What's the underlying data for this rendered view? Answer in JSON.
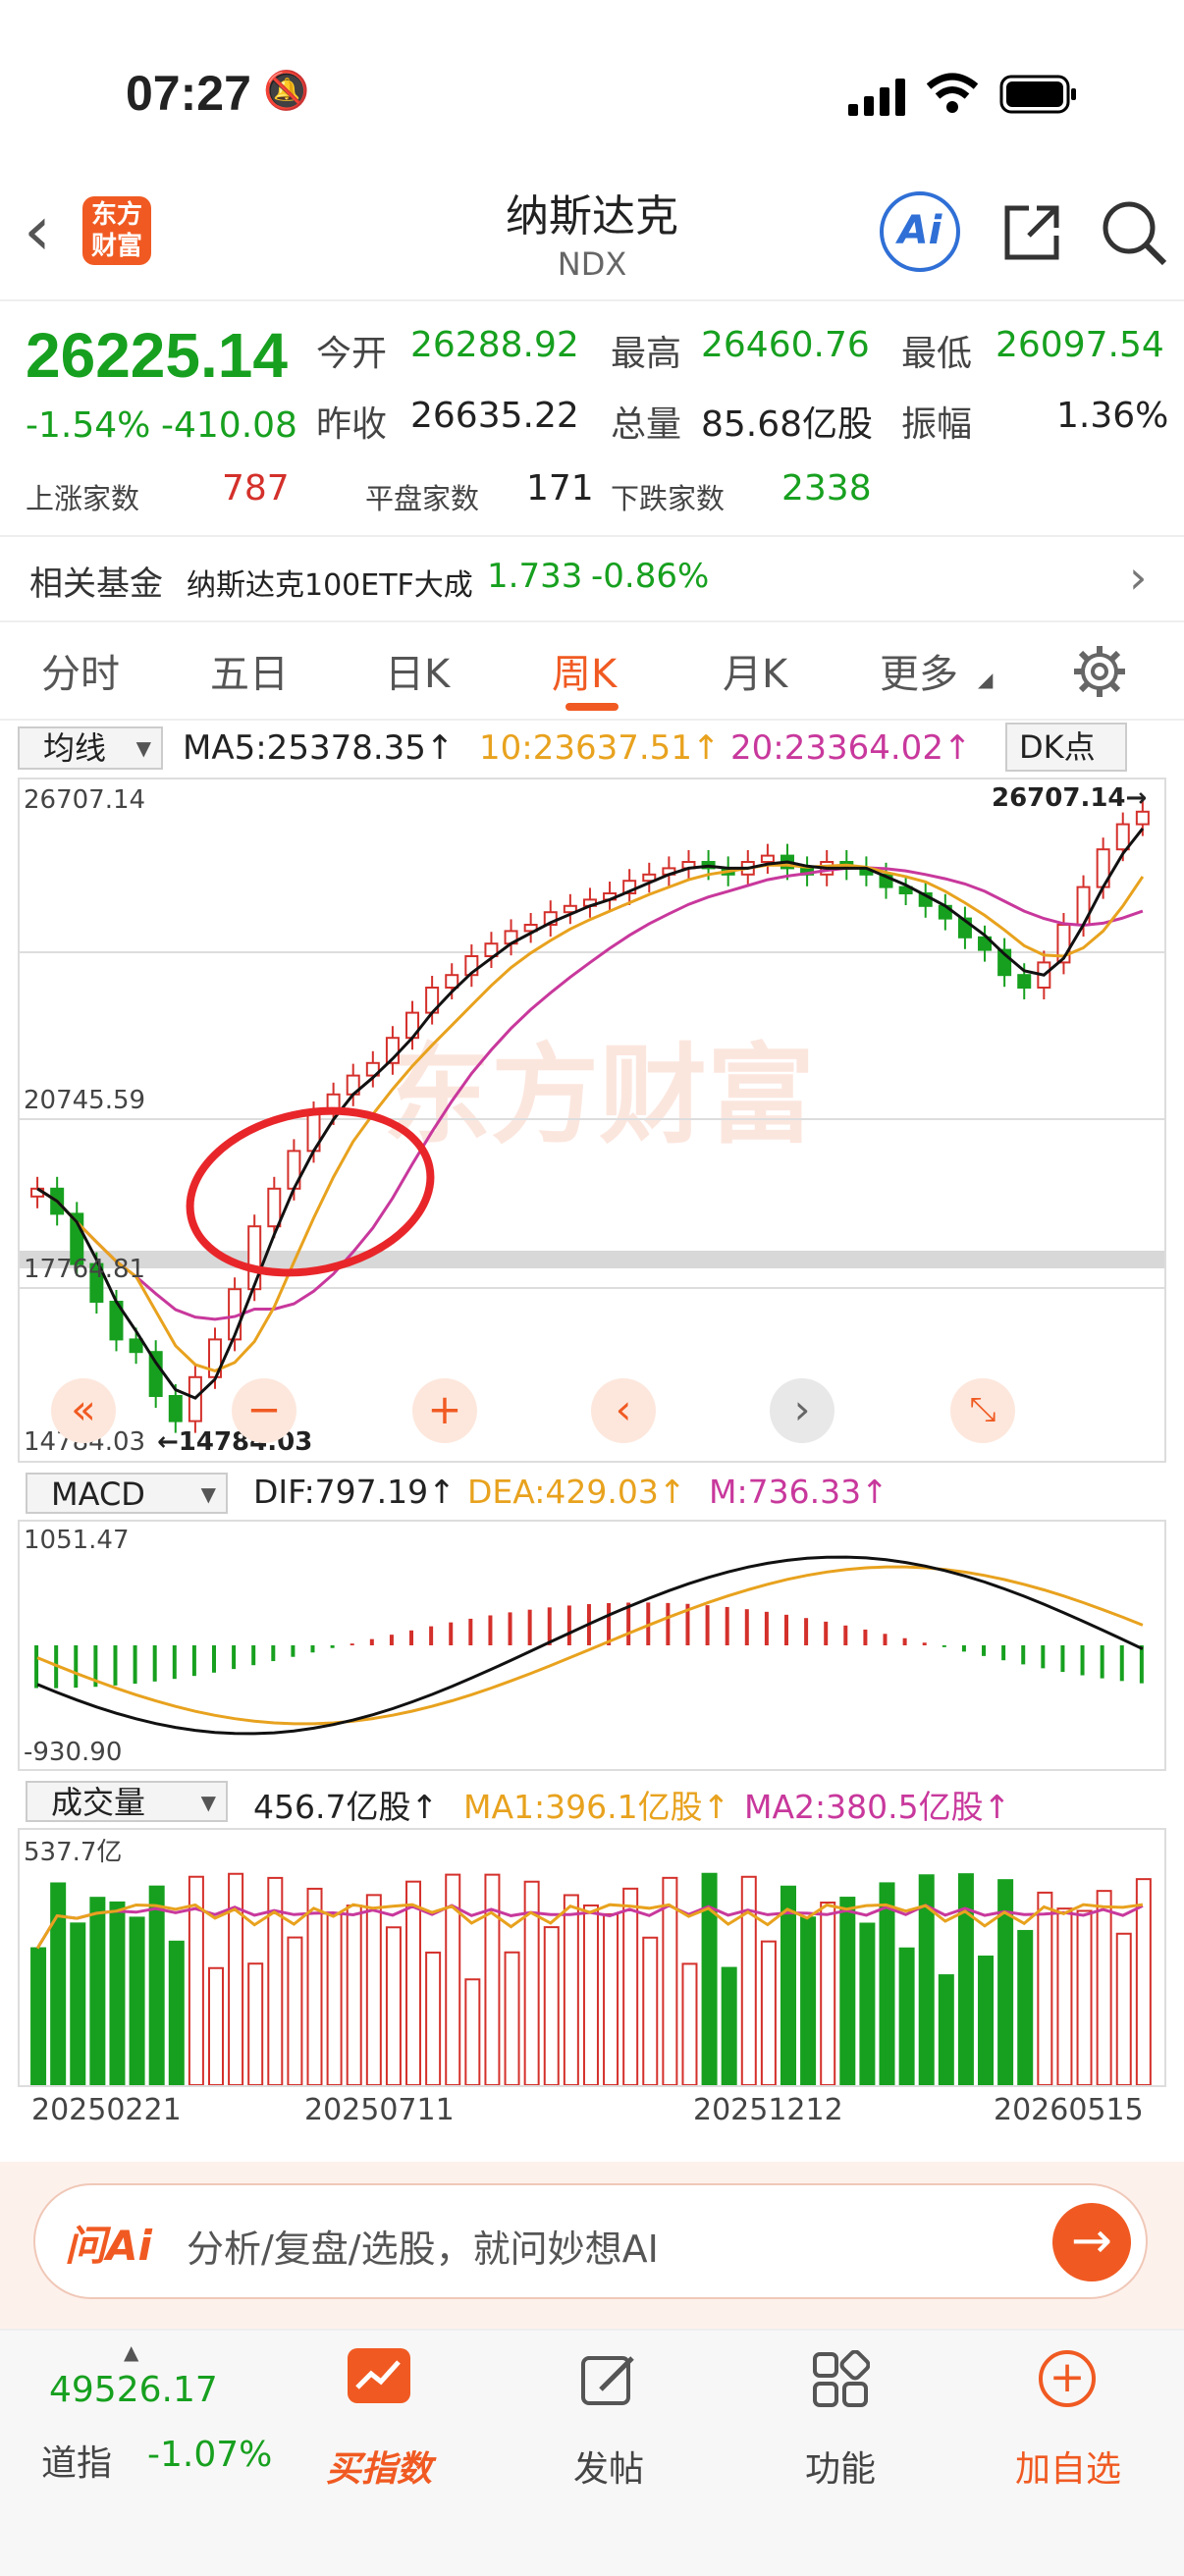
{
  "status": {
    "time": "07:27"
  },
  "header": {
    "title": "纳斯达克",
    "subtitle": "NDX",
    "logo_text": "东方\n财富",
    "ai_label": "Ai"
  },
  "quote": {
    "price": "26225.14",
    "change_pct": "-1.54%",
    "change": "-410.08",
    "open_label": "今开",
    "open": "26288.92",
    "high_label": "最高",
    "high": "26460.76",
    "low_label": "最低",
    "low": "26097.54",
    "prev_label": "昨收",
    "prev": "26635.22",
    "vol_label": "总量",
    "vol": "85.68亿股",
    "amp_label": "振幅",
    "amp": "1.36%",
    "up_label": "上涨家数",
    "up": "787",
    "flat_label": "平盘家数",
    "flat": "171",
    "down_label": "下跌家数",
    "down": "2338"
  },
  "fund": {
    "label": "相关基金",
    "name": "纳斯达克100ETF大成",
    "price": "1.733",
    "pct": "-0.86%"
  },
  "tabs": [
    "分时",
    "五日",
    "日K",
    "周K",
    "月K",
    "更多"
  ],
  "active_tab": 3,
  "kline": {
    "selector": "均线",
    "ma5": "MA5:25378.35↑",
    "ma10": "10:23637.51↑",
    "ma20": "20:23364.02↑",
    "dk": "DK点",
    "y_top": "26707.14",
    "y_mid": "20745.59",
    "y_low": "17764.81",
    "y_bot": "14784.03",
    "max_marker": "26707.14→",
    "min_marker": "←14784.03",
    "watermark": "东方财富"
  },
  "macd": {
    "selector": "MACD",
    "dif": "DIF:797.19↑",
    "dea": "DEA:429.03↑",
    "m": "M:736.33↑",
    "y_top": "1051.47",
    "y_bot": "-930.90"
  },
  "volume": {
    "selector": "成交量",
    "vol": "456.7亿股↑",
    "ma1": "MA1:396.1亿股↑",
    "ma2": "MA2:380.5亿股↑",
    "y_top": "537.7亿"
  },
  "dates": [
    "20250221",
    "20250711",
    "20251212",
    "20260515"
  ],
  "ai": {
    "brand": "问Ai",
    "placeholder": "分析/复盘/选股，就问妙想AI"
  },
  "nav": {
    "index_value": "49526.17",
    "index_name": "道指",
    "index_pct": "-1.07%",
    "items": [
      "买指数",
      "发帖",
      "功能",
      "加自选"
    ]
  },
  "colors": {
    "up": "#d4302b",
    "down": "#17a01f",
    "accent": "#f05a22",
    "ma10": "#e8a21e",
    "ma20": "#c8389c"
  }
}
